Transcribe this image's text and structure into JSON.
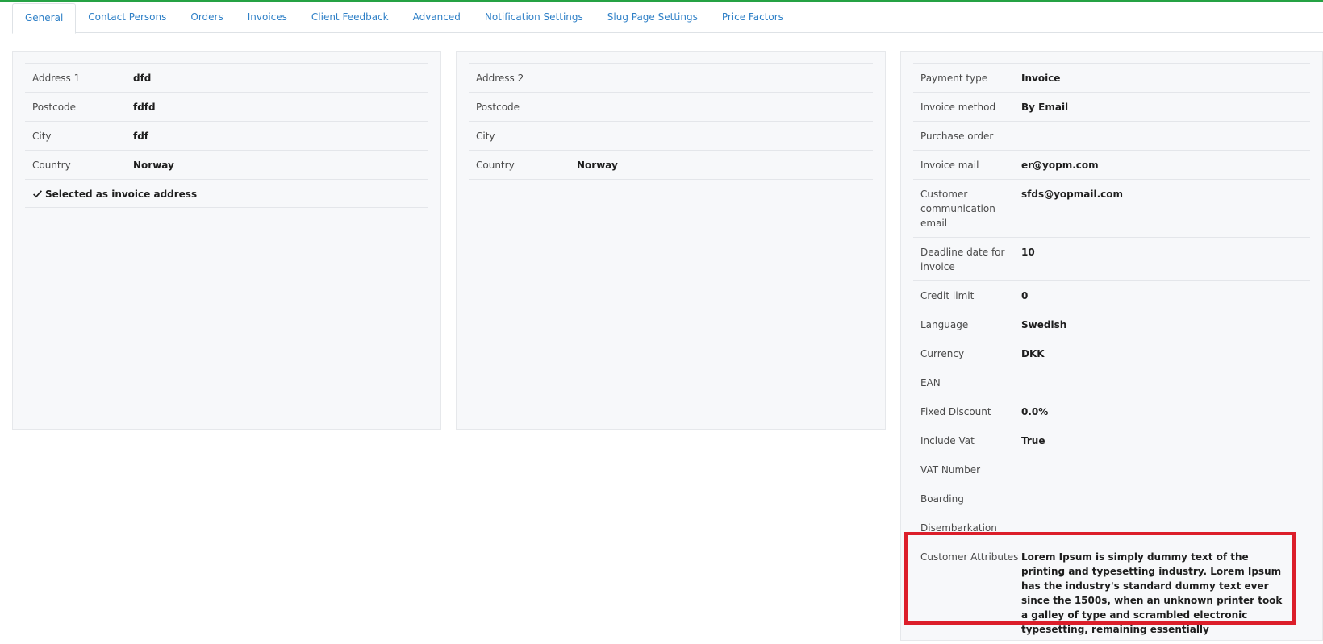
{
  "tabs": [
    "General",
    "Contact Persons",
    "Orders",
    "Invoices",
    "Client Feedback",
    "Advanced",
    "Notification Settings",
    "Slug Page Settings",
    "Price Factors"
  ],
  "address1": {
    "rows": [
      {
        "label": "Address 1",
        "value": "dfd"
      },
      {
        "label": "Postcode",
        "value": "fdfd"
      },
      {
        "label": "City",
        "value": "fdf"
      },
      {
        "label": "Country",
        "value": "Norway"
      }
    ],
    "selected_label": "Selected as invoice address"
  },
  "address2": {
    "rows": [
      {
        "label": "Address 2",
        "value": ""
      },
      {
        "label": "Postcode",
        "value": ""
      },
      {
        "label": "City",
        "value": ""
      },
      {
        "label": "Country",
        "value": "Norway"
      }
    ]
  },
  "billing": {
    "rows": [
      {
        "label": "Payment type",
        "value": "Invoice"
      },
      {
        "label": "Invoice method",
        "value": "By Email"
      },
      {
        "label": "Purchase order",
        "value": ""
      },
      {
        "label": "Invoice mail",
        "value": "er@yopm.com"
      },
      {
        "label": "Customer communication email",
        "value": "sfds@yopmail.com"
      },
      {
        "label": "Deadline date for invoice",
        "value": "10"
      },
      {
        "label": "Credit limit",
        "value": "0"
      },
      {
        "label": "Language",
        "value": "Swedish"
      },
      {
        "label": "Currency",
        "value": "DKK"
      },
      {
        "label": "EAN",
        "value": ""
      },
      {
        "label": "Fixed Discount",
        "value": "0.0%"
      },
      {
        "label": "Include Vat",
        "value": "True"
      },
      {
        "label": "VAT Number",
        "value": ""
      },
      {
        "label": "Boarding",
        "value": ""
      },
      {
        "label": "Disembarkation",
        "value": ""
      }
    ],
    "attributes": {
      "label": "Customer Attributes",
      "value": "Lorem Ipsum is simply dummy text of the printing and typesetting industry. Lorem Ipsum has the industry's standard dummy text ever since the 1500s, when an unknown printer took a galley of type and scrambled electronic typesetting, remaining essentially"
    }
  },
  "colors": {
    "tab_link": "#2f80c7",
    "top_line": "#25a244",
    "highlight": "#dc1e2a",
    "panel_bg": "#f7f8fa"
  }
}
